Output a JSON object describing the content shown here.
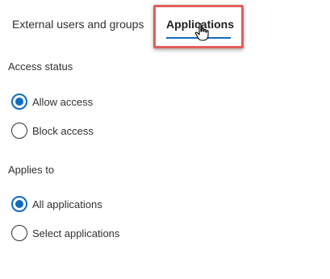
{
  "tabs": {
    "external_label": "External users and groups",
    "applications_label": "Applications",
    "selected": "Applications"
  },
  "access_status": {
    "label": "Access status",
    "options": [
      "Allow access",
      "Block access"
    ],
    "selected": "Allow access"
  },
  "applies_to": {
    "label": "Applies to",
    "options": [
      "All applications",
      "Select applications"
    ],
    "selected": "All applications"
  },
  "colors": {
    "accent": "#0f6cbd",
    "highlight": "#e35d5d"
  },
  "icons": {
    "cursor": "hand-pointer-icon"
  }
}
